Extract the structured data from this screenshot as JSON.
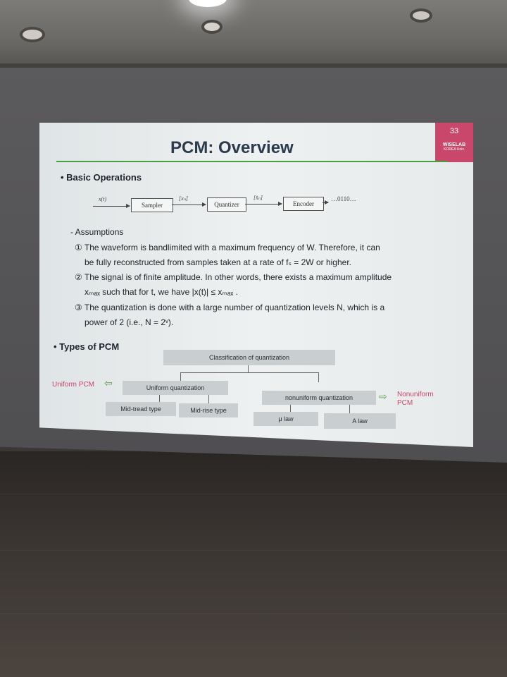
{
  "slide": {
    "number": "33",
    "lab_name": "WISELAB",
    "lab_sub": "KOREA Univ.",
    "title": "PCM: Overview",
    "basic_heading": "• Basic Operations",
    "diagram": {
      "input": "x(t)",
      "blocks": [
        "Sampler",
        "Quantizer",
        "Encoder"
      ],
      "signal1": "[xₙ]",
      "signal2": "[x̂ₙ]",
      "output": "…0110…"
    },
    "assumptions_heading": "- Assumptions",
    "lines": [
      "① The waveform is bandlimited with a maximum frequency of W. Therefore, it can",
      "be fully reconstructed from samples taken at a rate of fₛ = 2W  or higher.",
      "② The signal is of finite amplitude. In other words, there exists a maximum amplitude",
      "xₘₐₓ  such that for t, we have |x(t)| ≤ xₘₐₓ .",
      "③ The quantization is done with a large number of quantization levels N, which is a",
      "power of 2 (i.e., N = 2ᵛ)."
    ],
    "types_heading": "• Types of PCM",
    "classification": "Classification of quantization",
    "uniform_label": "Uniform PCM",
    "uniform_box": "Uniform quantization",
    "nonuniform_box": "nonuniform quantization",
    "nonuniform_label": "Nonuniform PCM",
    "leaves": [
      "Mid-tread type",
      "Mid-rise type",
      "μ  law",
      "A  law"
    ]
  }
}
